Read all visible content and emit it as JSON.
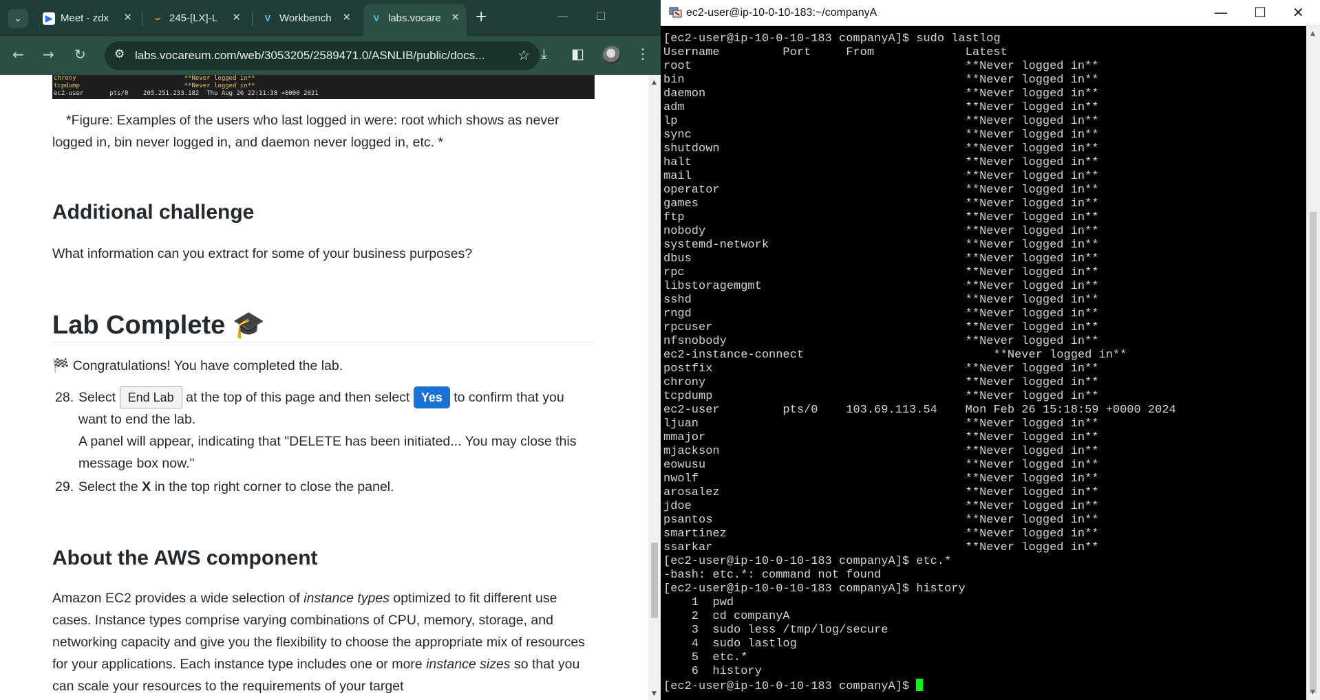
{
  "browser": {
    "tabs": [
      {
        "label": "Meet - zdx",
        "icon": "meet-icon"
      },
      {
        "label": "245-[LX]-L",
        "icon": "aws-icon"
      },
      {
        "label": "Workbench",
        "icon": "vocareum-icon"
      },
      {
        "label": "labs.vocare",
        "icon": "vocareum-icon",
        "active": true
      }
    ],
    "url": "labs.vocareum.com/web/3053205/2589471.0/ASNLIB/public/docs...",
    "accent": "#2d5046"
  },
  "page": {
    "terminal_snippet": [
      "chrony                             **Never logged in**",
      "tcpdump                            **Never logged in**",
      "ec2-user       pts/0    205.251.233.182  Thu Aug 26 22:11:38 +0000 2021"
    ],
    "figure_caption": "*Figure: Examples of the users who last logged in were: root which shows as never logged in, bin never logged in, and daemon never logged in, etc. *",
    "challenge_heading": "Additional challenge",
    "challenge_text": "What information can you extract for some of your business purposes?",
    "complete_heading": "Lab Complete",
    "congrats": "Congratulations! You have completed the lab.",
    "step28": {
      "num": "28.",
      "pre": "Select",
      "end_btn": "End Lab",
      "mid": "at the top of this page and then select",
      "yes_btn": "Yes",
      "post": "to confirm that you want to end the lab.",
      "panel_text": "A panel will appear, indicating that \"DELETE has been initiated... You may close this message box now.\""
    },
    "step29": {
      "num": "29.",
      "pre": "Select the",
      "bold": "X",
      "post": "in the top right corner to close the panel."
    },
    "aws_heading": "About the AWS component",
    "aws_p1": "Amazon EC2 provides a wide selection of",
    "aws_i1": "instance types",
    "aws_p2": "optimized to fit different use cases. Instance types comprise varying combinations of CPU, memory, storage, and networking capacity and give you the flexibility to choose the appropriate mix of resources for your applications. Each instance type includes one or more",
    "aws_i2": "instance sizes",
    "aws_p3": "so that you can scale your resources to the requirements of your target"
  },
  "terminal": {
    "title": "ec2-user@ip-10-0-10-183:~/companyA",
    "lines": [
      "[ec2-user@ip-10-0-10-183 companyA]$ sudo lastlog",
      "Username         Port     From             Latest",
      "root                                       **Never logged in**",
      "bin                                        **Never logged in**",
      "daemon                                     **Never logged in**",
      "adm                                        **Never logged in**",
      "lp                                         **Never logged in**",
      "sync                                       **Never logged in**",
      "shutdown                                   **Never logged in**",
      "halt                                       **Never logged in**",
      "mail                                       **Never logged in**",
      "operator                                   **Never logged in**",
      "games                                      **Never logged in**",
      "ftp                                        **Never logged in**",
      "nobody                                     **Never logged in**",
      "systemd-network                            **Never logged in**",
      "dbus                                       **Never logged in**",
      "rpc                                        **Never logged in**",
      "libstoragemgmt                             **Never logged in**",
      "sshd                                       **Never logged in**",
      "rngd                                       **Never logged in**",
      "rpcuser                                    **Never logged in**",
      "nfsnobody                                  **Never logged in**",
      "ec2-instance-connect                           **Never logged in**",
      "postfix                                    **Never logged in**",
      "chrony                                     **Never logged in**",
      "tcpdump                                    **Never logged in**",
      "ec2-user         pts/0    103.69.113.54    Mon Feb 26 15:18:59 +0000 2024",
      "ljuan                                      **Never logged in**",
      "mmajor                                     **Never logged in**",
      "mjackson                                   **Never logged in**",
      "eowusu                                     **Never logged in**",
      "nwolf                                      **Never logged in**",
      "arosalez                                   **Never logged in**",
      "jdoe                                       **Never logged in**",
      "psantos                                    **Never logged in**",
      "smartinez                                  **Never logged in**",
      "ssarkar                                    **Never logged in**",
      "[ec2-user@ip-10-0-10-183 companyA]$ etc.*",
      "-bash: etc.*: command not found",
      "[ec2-user@ip-10-0-10-183 companyA]$ history",
      "    1  pwd",
      "    2  cd companyA",
      "    3  sudo less /tmp/log/secure",
      "    4  sudo lastlog",
      "    5  etc.*",
      "    6  history"
    ],
    "prompt": "[ec2-user@ip-10-0-10-183 companyA]$ ",
    "cursor_color": "#00ff00"
  }
}
